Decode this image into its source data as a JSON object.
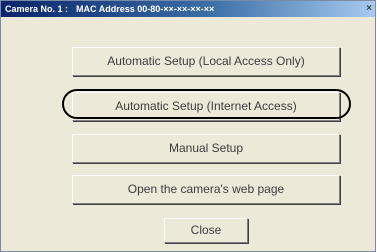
{
  "titlebar": {
    "camera_label": "Camera No. 1 :",
    "mac_label": "MAC Address",
    "mac_value": "00-80-××-××-××-××",
    "close_glyph": "×"
  },
  "buttons": {
    "auto_local": "Automatic Setup (Local Access Only)",
    "auto_internet": "Automatic Setup (Internet Access)",
    "manual": "Manual Setup",
    "open_web": "Open the camera's web page",
    "close": "Close"
  }
}
